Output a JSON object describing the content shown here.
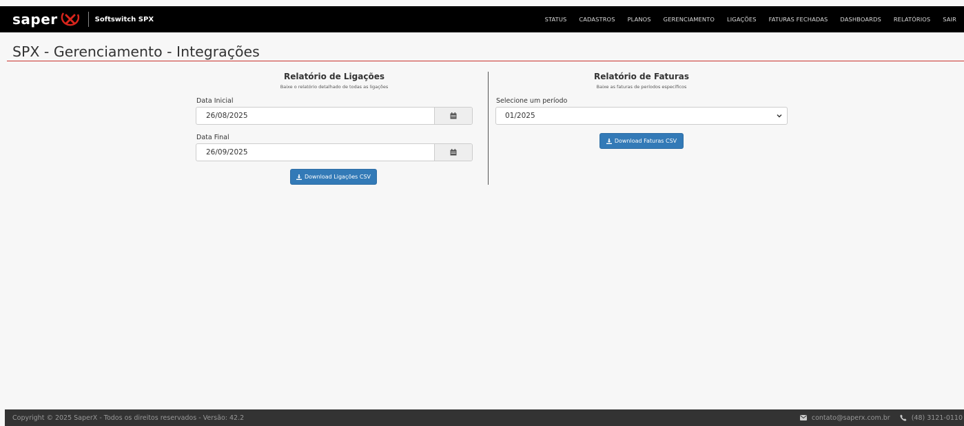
{
  "header": {
    "brand": "saper",
    "product": "Softswitch SPX",
    "nav": [
      "STATUS",
      "CADASTROS",
      "PLANOS",
      "GERENCIAMENTO",
      "LIGAÇÕES",
      "FATURAS FECHADAS",
      "DASHBOARDS",
      "RELATÓRIOS",
      "SAIR"
    ]
  },
  "page": {
    "title": "SPX - Gerenciamento - Integrações"
  },
  "ligacoes": {
    "title": "Relatório de Ligações",
    "subtitle": "Baixe o relatório detalhado de todas as ligações",
    "start_label": "Data Inicial",
    "start_value": "26/08/2025",
    "end_label": "Data Final",
    "end_value": "26/09/2025",
    "download_label": "Download Ligações CSV"
  },
  "faturas": {
    "title": "Relatório de Faturas",
    "subtitle": "Baixe as faturas de períodos específicos",
    "period_label": "Selecione um período",
    "period_value": "01/2025",
    "download_label": "Download Faturas CSV"
  },
  "footer": {
    "copyright": "Copyright © 2025 SaperX - Todos os direitos reservados - Versão: 42.2",
    "email": "contato@saperx.com.br",
    "phone": "(48) 3121-0110"
  },
  "colors": {
    "accent": "#337ab7",
    "title_rule": "#c9302c",
    "brand_red": "#d9251c"
  },
  "icons": [
    "brand-x-logo-icon",
    "calendar-icon",
    "download-icon",
    "chevron-down-icon",
    "envelope-icon",
    "phone-icon"
  ]
}
